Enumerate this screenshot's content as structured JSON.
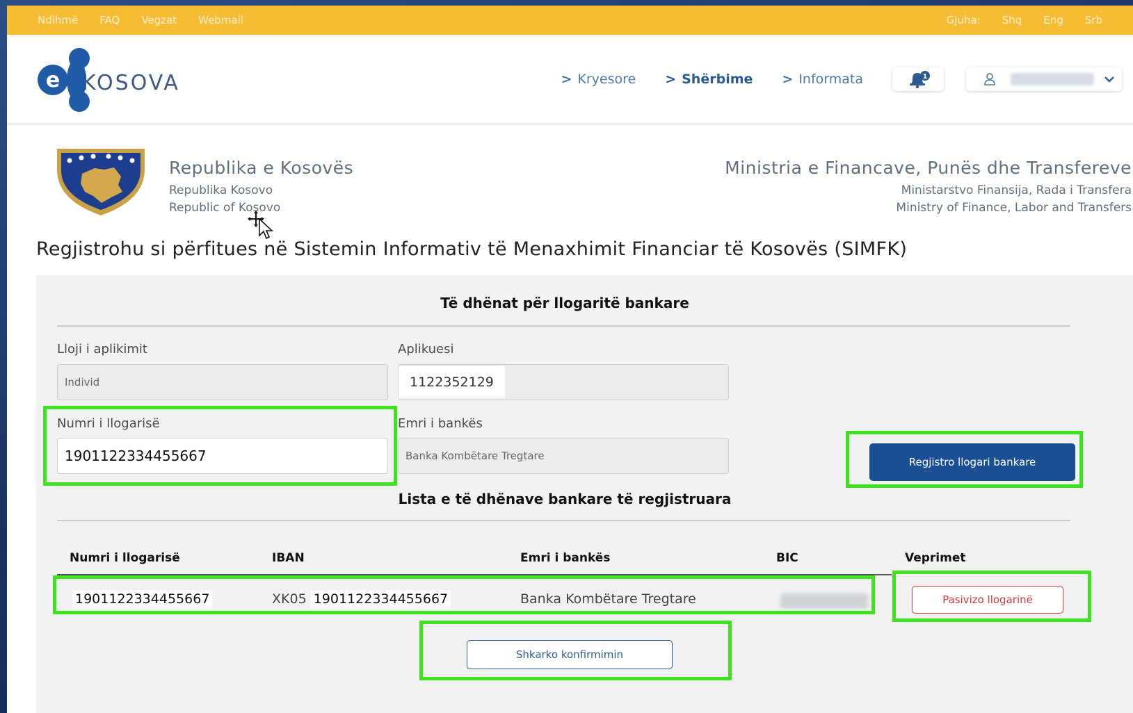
{
  "topbar": {
    "links": [
      "Ndihmë",
      "FAQ",
      "Vegzat",
      "Webmail"
    ],
    "language_label": "Gjuha:",
    "languages": [
      "Shq",
      "Eng",
      "Srb"
    ]
  },
  "header": {
    "logo_text": "KOSOVA",
    "logo_letter": "e",
    "nav": [
      {
        "label": "Kryesore",
        "active": false
      },
      {
        "label": "Shërbime",
        "active": true
      },
      {
        "label": "Informata",
        "active": false
      }
    ],
    "notification_count": "1"
  },
  "gov": {
    "left_title": "Republika e Kosovës",
    "left_sub1": "Republika Kosovo",
    "left_sub2": "Republic of Kosovo",
    "right_title": "Ministria e Financave, Punës dhe Transfereve",
    "right_sub1": "Ministarstvo Finansija, Rada i Transfera",
    "right_sub2": "Ministry of Finance, Labor and Transfers"
  },
  "page_title": "Regjistrohu si përfitues në Sistemin Informativ të Menaxhimit Financiar të Kosovës (SIMFK)",
  "form": {
    "section_title": "Të dhënat për llogaritë bankare",
    "application_type_label": "Lloji i aplikimit",
    "application_type_value": "Individ",
    "applicant_label": "Aplikuesi",
    "applicant_value": "1122352129",
    "account_number_label": "Numri i llogarisë",
    "account_number_value": "1901122334455667",
    "bank_name_label": "Emri i bankës",
    "bank_name_value": "Banka Kombëtare Tregtare",
    "register_button": "Regjistro llogari bankare"
  },
  "table": {
    "section_title": "Lista e të dhënave bankare të regjistruara",
    "headers": [
      "Numri i llogarisë",
      "IBAN",
      "Emri i bankës",
      "BIC",
      "Veprimet"
    ],
    "rows": [
      {
        "account": "1901122334455667",
        "iban_prefix": "XK05",
        "iban_number": "1901122334455667",
        "bank": "Banka Kombëtare Tregtare"
      }
    ],
    "deactivate_button": "Pasivizo llogarinë",
    "download_button": "Shkarko konfirmimin"
  },
  "colors": {
    "topbar": "#f6bc33",
    "primary": "#1b4f93",
    "danger": "#d63a3a",
    "highlight": "#3fe21f"
  },
  "icons": [
    "ekosova-logo-icon",
    "bell-icon",
    "user-icon",
    "chevron-down-icon",
    "kosovo-emblem-icon",
    "move-cursor-icon"
  ]
}
